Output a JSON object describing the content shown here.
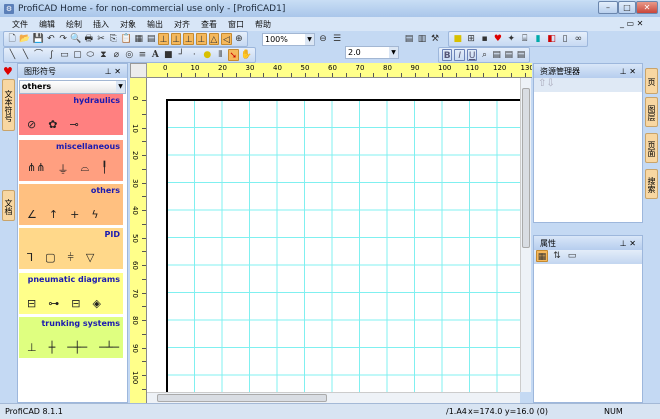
{
  "window": {
    "title": "ProfiCAD Home - for non-commercial use only - [ProfiCAD1]",
    "minimize": "–",
    "maximize": "□",
    "close": "✕"
  },
  "menu": [
    "文件",
    "编辑",
    "绘制",
    "插入",
    "对象",
    "输出",
    "对齐",
    "查看",
    "窗口",
    "帮助"
  ],
  "toolbar": {
    "zoom_value": "100%",
    "line_width": "2.0",
    "font_name": "",
    "font_size": "",
    "bold": "B",
    "italic": "I",
    "underline": "U"
  },
  "left_tabs": [
    "文本符号",
    "文档"
  ],
  "symbols_panel": {
    "title": "图形符号",
    "category": "others",
    "groups": [
      {
        "name": "hydraulics",
        "color": "#ff8080",
        "symbols": [
          "⊘",
          "✿",
          "⊸"
        ]
      },
      {
        "name": "miscellaneous",
        "color": "#ff9f80",
        "symbols": [
          "⋔⋔",
          "⏚",
          "⌓",
          "╿"
        ]
      },
      {
        "name": "others",
        "color": "#ffc080",
        "symbols": [
          "∠",
          "↑",
          "+",
          "ϟ"
        ]
      },
      {
        "name": "PID",
        "color": "#ffd88a",
        "symbols": [
          "⅂",
          "▢",
          "⫩",
          "▽"
        ]
      },
      {
        "name": "pneumatic diagrams",
        "color": "#ffff8a",
        "symbols": [
          "⊟",
          "⊶",
          "⊟",
          "◈"
        ]
      },
      {
        "name": "trunking systems",
        "color": "#dfff80",
        "symbols": [
          "⊥",
          "┼",
          "─┼─",
          "─┴─"
        ]
      }
    ]
  },
  "ruler": {
    "h_labels": [
      "0",
      "10",
      "20",
      "30",
      "40",
      "50",
      "60",
      "70",
      "80",
      "90",
      "100",
      "110",
      "120",
      "130"
    ],
    "v_labels": [
      "0",
      "10",
      "20",
      "30",
      "40",
      "50",
      "60",
      "70",
      "80",
      "90",
      "100"
    ]
  },
  "resource_panel": {
    "title": "资源管理器"
  },
  "properties_panel": {
    "title": "属性"
  },
  "right_tabs": [
    "页",
    "图层",
    "页面",
    "搜索"
  ],
  "grid_color": "#80f0f0",
  "status": {
    "version": "ProfiCAD 8.1.1",
    "page": "/1.A4",
    "coords": "x=174.0  y=16.0 (0)",
    "num": "NUM"
  }
}
